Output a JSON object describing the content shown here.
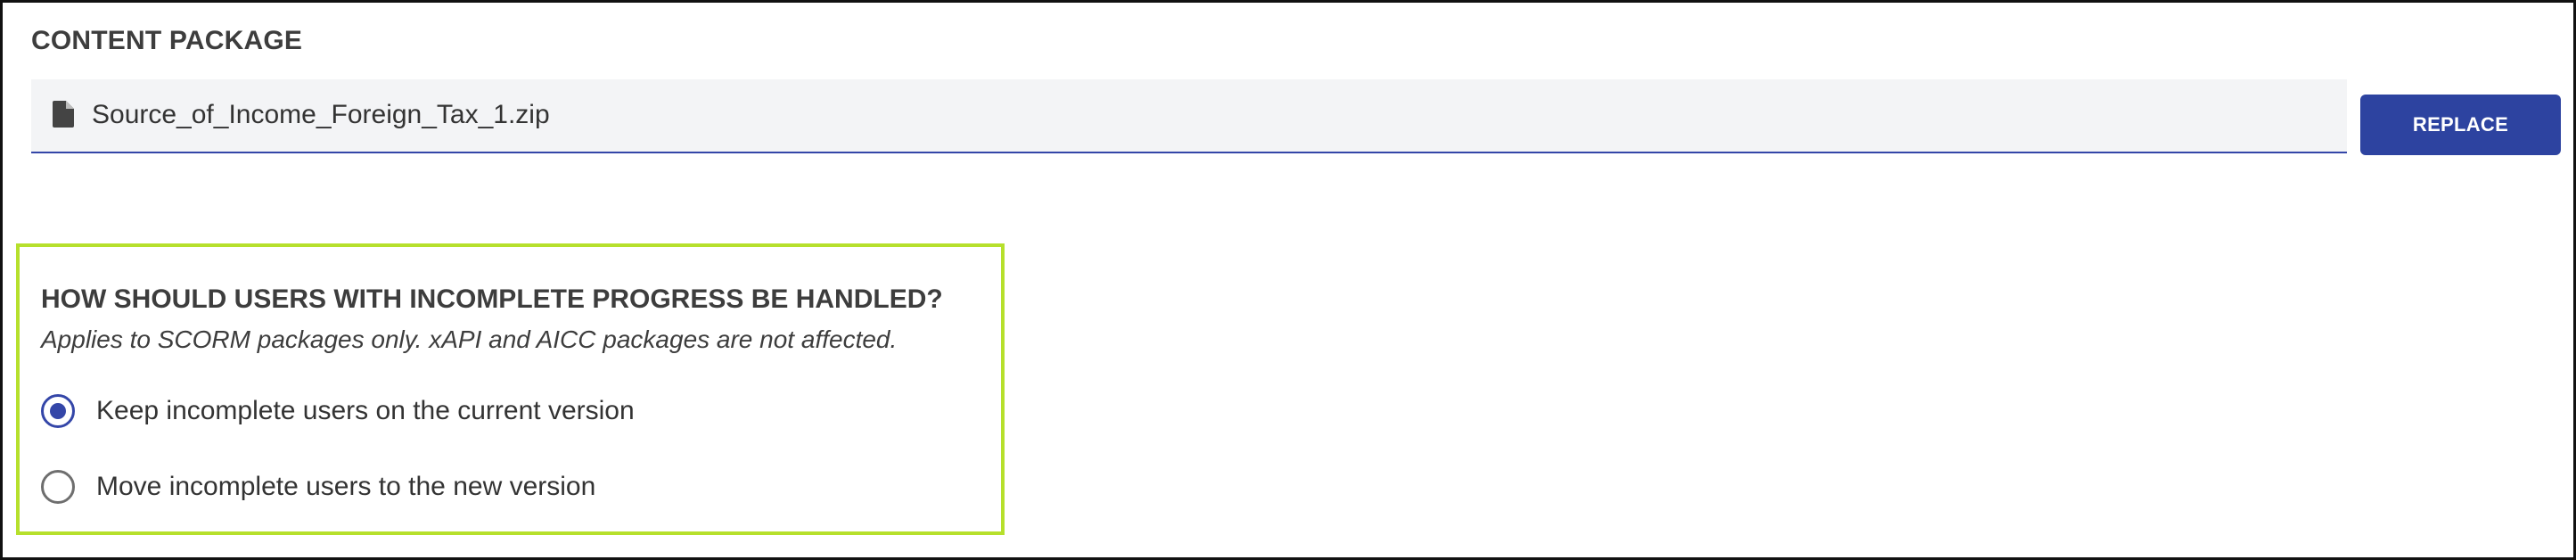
{
  "section": {
    "title": "CONTENT PACKAGE"
  },
  "file": {
    "icon": "file-icon",
    "name": "Source_of_Income_Foreign_Tax_1.zip"
  },
  "replace_button": {
    "label": "REPLACE"
  },
  "incomplete_progress": {
    "question": "HOW SHOULD USERS WITH INCOMPLETE PROGRESS BE HANDLED?",
    "subtitle": "Applies to SCORM packages only. xAPI and AICC packages are not affected.",
    "options": [
      {
        "label": "Keep incomplete users on the current version",
        "checked": true
      },
      {
        "label": "Move incomplete users to the new version",
        "checked": false
      }
    ]
  },
  "colors": {
    "accent": "#2d43a0",
    "highlight": "#b6e02c"
  }
}
